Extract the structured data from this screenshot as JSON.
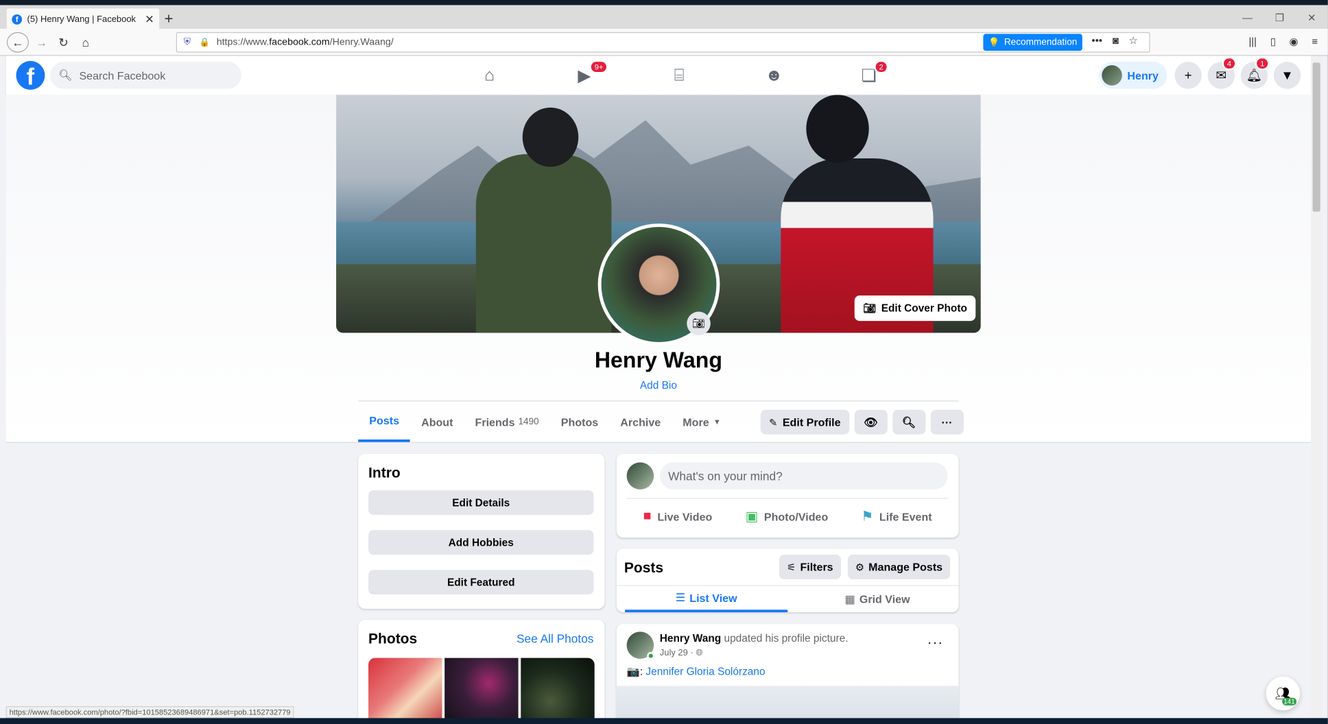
{
  "browser": {
    "tab_title": "(5) Henry Wang | Facebook",
    "url_prefix": "https://www.",
    "url_domain": "facebook.com",
    "url_path": "/Henry.Waang/",
    "recommendation": "Recommendation",
    "status_url": "https://www.facebook.com/photo/?fbid=10158523689486971&set=pob.1152732779"
  },
  "fb": {
    "search_placeholder": "Search Facebook",
    "nav_badges": {
      "watch": "9+",
      "gaming": "2"
    },
    "user_chip": "Henry",
    "messenger_badge": "4",
    "notifications_badge": "1"
  },
  "profile": {
    "name": "Henry Wang",
    "add_bio": "Add Bio",
    "edit_cover": "Edit Cover Photo",
    "tabs": [
      "Posts",
      "About",
      "Friends",
      "Photos",
      "Archive",
      "More"
    ],
    "friends_count": "1490",
    "edit_profile": "Edit Profile"
  },
  "intro": {
    "title": "Intro",
    "buttons": [
      "Edit Details",
      "Add Hobbies",
      "Edit Featured"
    ]
  },
  "photos": {
    "title": "Photos",
    "see_all": "See All Photos"
  },
  "composer": {
    "placeholder": "What's on your mind?",
    "actions": [
      "Live Video",
      "Photo/Video",
      "Life Event"
    ]
  },
  "posts": {
    "title": "Posts",
    "filters": "Filters",
    "manage": "Manage Posts",
    "list_view": "List View",
    "grid_view": "Grid View"
  },
  "post": {
    "author": "Henry Wang",
    "action": " updated his profile picture.",
    "date": "July 29 · ",
    "caption_prefix": "📷: ",
    "caption_name": "Jennifer Gloria Solórzano"
  },
  "contacts_count": "141",
  "colors": {
    "fb_blue": "#1877f2",
    "badge_red": "#e41e3f"
  }
}
